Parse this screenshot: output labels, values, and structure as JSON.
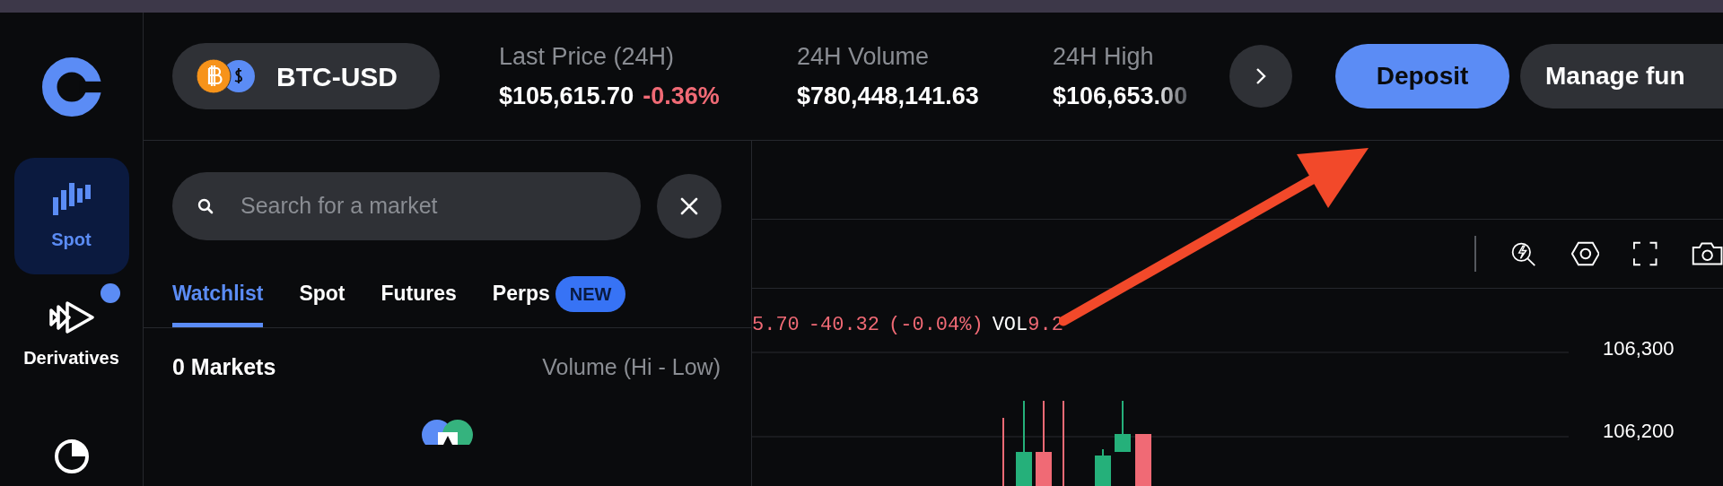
{
  "sidebar": {
    "items": [
      {
        "kind": "bars",
        "label": "Spot",
        "selected": true,
        "dot": false
      },
      {
        "kind": "arrows",
        "label": "Derivatives",
        "selected": false,
        "dot": true
      },
      {
        "kind": "pie",
        "selected": false,
        "dot": false
      }
    ]
  },
  "market": {
    "pair": "BTC-USD"
  },
  "stats": [
    {
      "label": "Last Price (24H)",
      "value": "$105,615.70",
      "change": "-0.36%"
    },
    {
      "label": "24H Volume",
      "value": "$780,448,141.63"
    },
    {
      "label": "24H High",
      "value": "$106,653.00"
    }
  ],
  "actions": [
    {
      "kind": "primary",
      "label": "Deposit"
    },
    {
      "kind": "secondary",
      "label": "Manage fun"
    }
  ],
  "search": {
    "placeholder": "Search for a market"
  },
  "tabs": [
    {
      "label": "Watchlist",
      "selected": true
    },
    {
      "label": "Spot",
      "selected": false
    },
    {
      "label": "Futures",
      "selected": false
    },
    {
      "label": "Perps",
      "selected": false,
      "badge": "NEW"
    }
  ],
  "list_header": {
    "count": "0 Markets",
    "sort": "Volume (Hi - Low)"
  },
  "chart": {
    "legend": [
      "5.70",
      "-40.32",
      "(-0.04%)"
    ],
    "vol_label": "VOL",
    "vol_value": "9.2",
    "price_labels": [
      "106,300",
      "106,200"
    ]
  }
}
